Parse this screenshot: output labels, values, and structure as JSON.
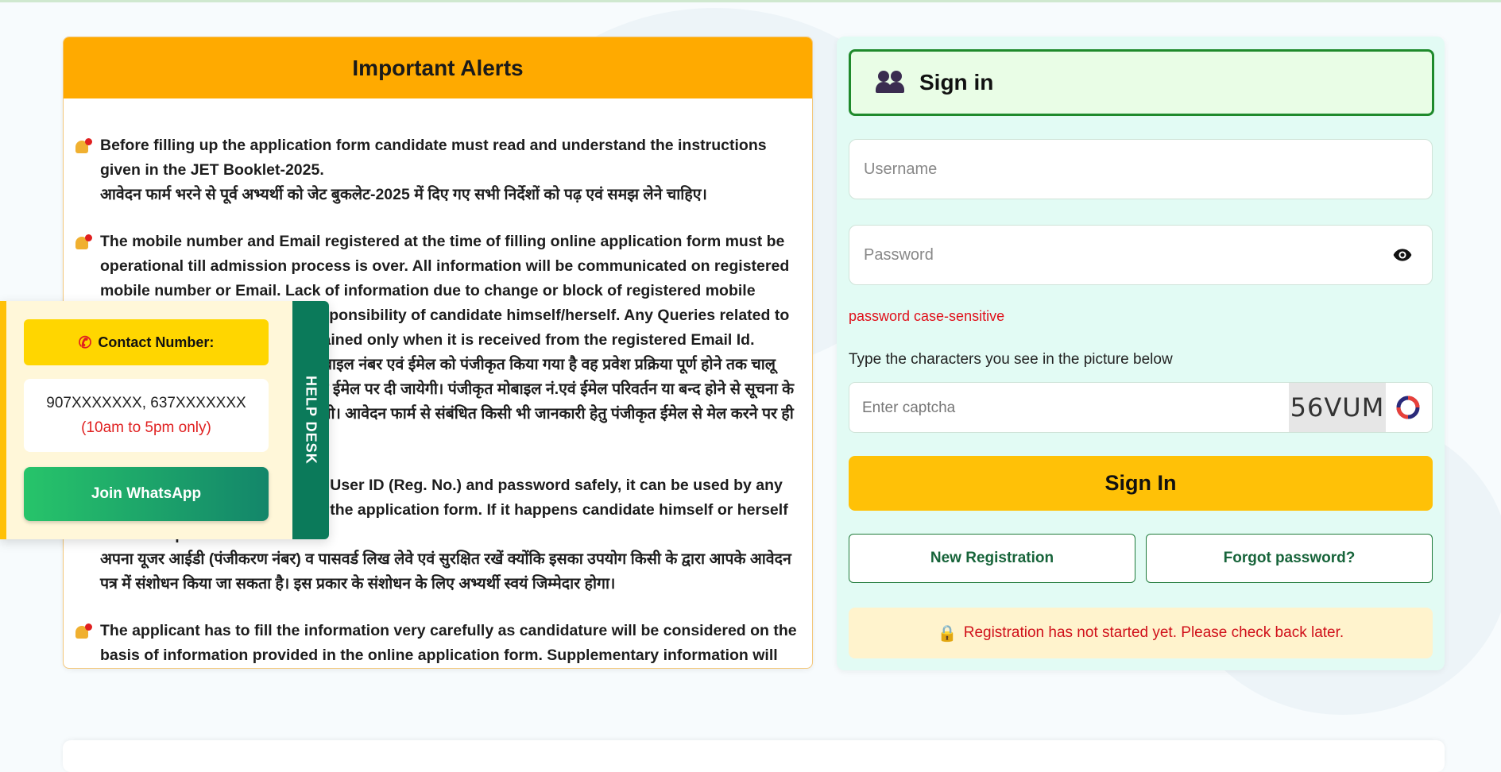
{
  "alerts": {
    "title": "Important Alerts",
    "items": [
      {
        "en": "Before filling up the application form candidate must read and understand the instructions given in the JET Booklet-2025.",
        "hi": "आवेदन फार्म भरने से पूर्व अभ्यर्थी को जेट बुकलेट-2025 में दिए गए सभी निर्देशों को पढ़ एवं समझ लेने चाहिए।"
      },
      {
        "en": "The mobile number and Email registered at the time of filling online application form must be operational till admission process is over. All information will be communicated on registered mobile number or Email. Lack of information due to change or block of registered mobile number or Email will be the responsibility of candidate himself/herself. Any Queries related to Application form will be entertained only when it is received from the registered Email Id.",
        "hi": "ऑनलाइन आवेदन पत्र भरते समय जो मोबाइल नंबर एवं ईमेल को पंजीकृत किया गया है वह प्रवेश प्रक्रिया पूर्ण होने तक चालू रखें। सभी सूचना पंजीकृत मोबाइल नं. एवं ईमेल पर दी जायेगी। पंजीकृत मोबाइल नं.एवं ईमेल परिवर्तन या बन्द होने से सूचना के अभाव की जिम्मेदारी स्वयं अभ्यर्थी की होगी। आवेदन फार्म से संबंधित किसी भी जानकारी हेतु पंजीकृत ईमेल से मेल करने पर ही संतोषजनक उत्तर दिया जाता है।"
      },
      {
        "en": "Candidate must note down the User ID (Reg. No.) and password safely, it can be used by any one for making modification in the application form. If it happens candidate himself or herself will be responsible.",
        "hi": "अपना यूजर आईडी (पंजीकरण नंबर) व पासवर्ड लिख लेवे एवं सुरक्षित रखें क्योंकि इसका उपयोग किसी के द्वारा आपके आवेदन पत्र में संशोधन किया जा सकता है। इस प्रकार के संशोधन के लिए अभ्यर्थी स्वयं जिम्मेदार होगा।"
      },
      {
        "en": "The applicant has to fill the information very carefully as candidature will be considered on the basis of information provided in the online application form. Supplementary information will not be entertained.",
        "hi": ""
      }
    ]
  },
  "helpdesk": {
    "tab_label": "HELP DESK",
    "contact_label": "Contact Number:",
    "numbers": "907XXXXXXX, 637XXXXXXX",
    "hours": "(10am to 5pm only)",
    "whatsapp_label": "Join WhatsApp"
  },
  "signin": {
    "title": "Sign in",
    "username_placeholder": "Username",
    "password_placeholder": "Password",
    "password_hint": "password case-sensitive",
    "captcha_label": "Type the characters you see in the picture below",
    "captcha_placeholder": "Enter captcha",
    "captcha_text": "56VUM",
    "signin_button": "Sign In",
    "new_registration": "New Registration",
    "forgot_password": "Forgot password?",
    "notice": "Registration has not started yet. Please check back later."
  },
  "colors": {
    "alerts_header": "#ffaa00",
    "helpdesk_tab": "#0b7a5a",
    "signin_button": "#ffc107",
    "error_text": "#e0101a"
  },
  "icons": [
    "bell-icon",
    "phone-icon",
    "users-icon",
    "eye-icon",
    "refresh-icon",
    "lock-icon"
  ]
}
